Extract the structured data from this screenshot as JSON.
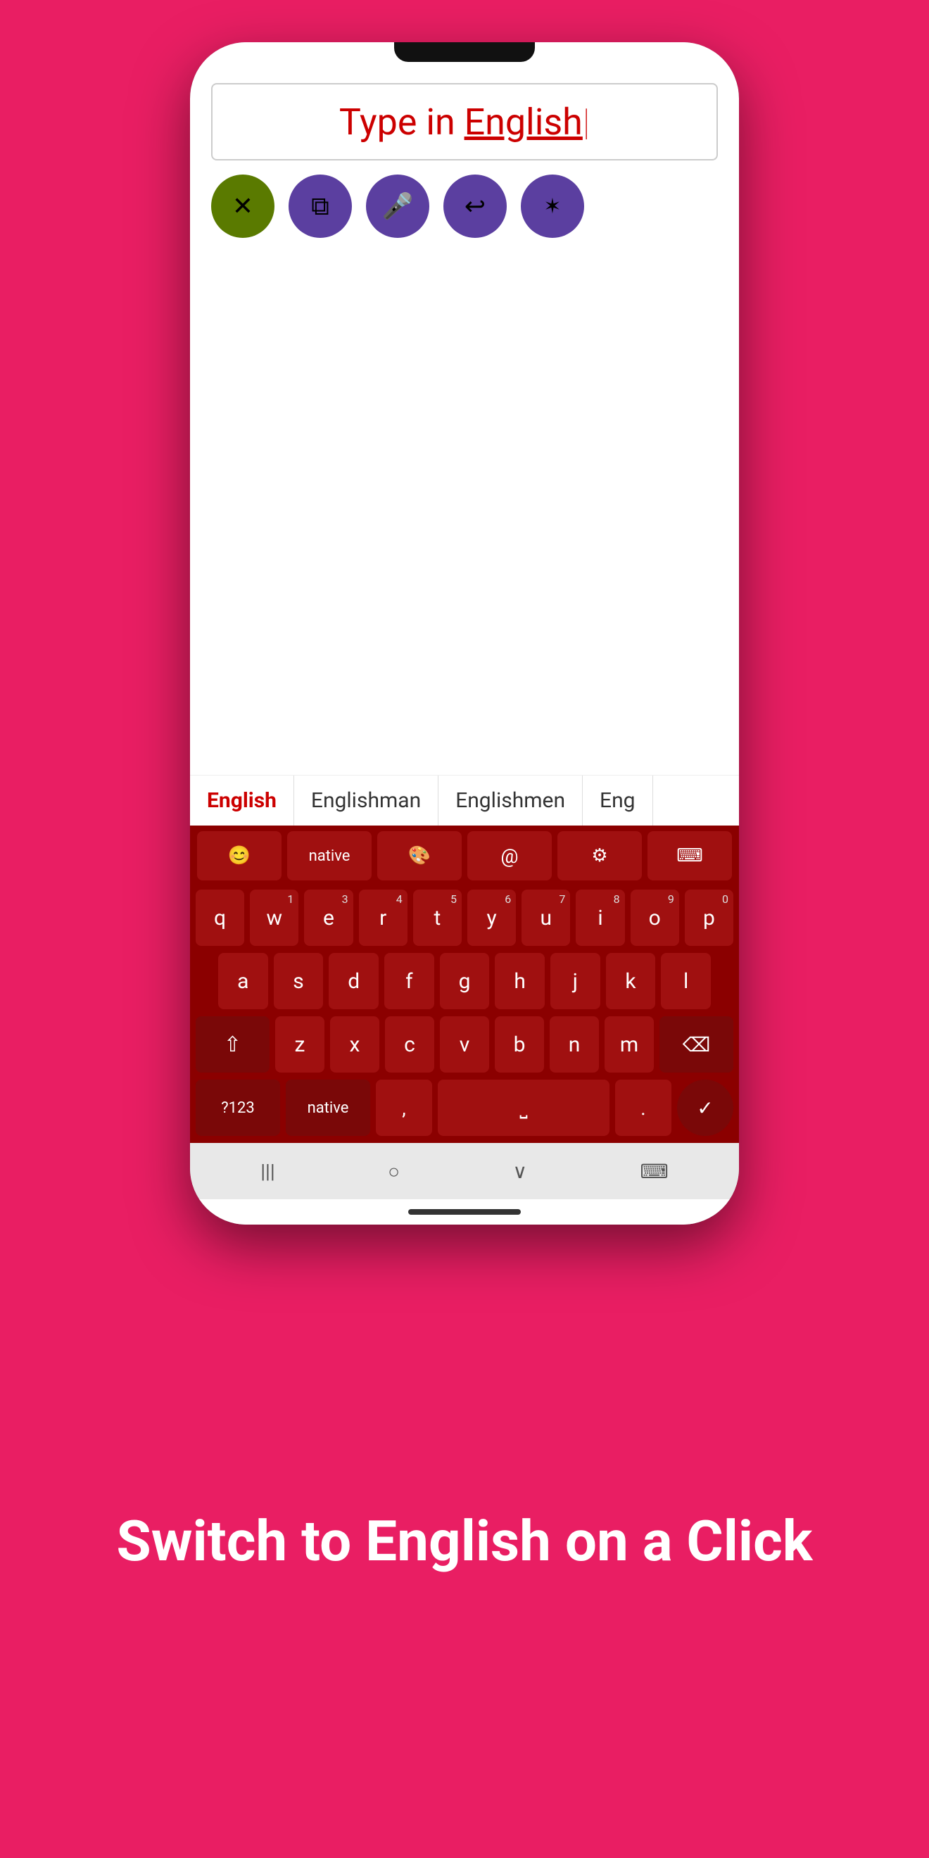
{
  "app": {
    "background_color": "#E91E63"
  },
  "phone": {
    "text_area": {
      "content": "Type in English",
      "type_label": "Type in ",
      "english_label": "English"
    },
    "action_buttons": [
      {
        "id": "delete",
        "icon": "⌫",
        "bg": "#5a7a00",
        "label": "delete"
      },
      {
        "id": "copy",
        "icon": "⧉",
        "bg": "#5b3fa0",
        "label": "copy"
      },
      {
        "id": "mic",
        "icon": "🎤",
        "bg": "#5b3fa0",
        "label": "microphone"
      },
      {
        "id": "undo",
        "icon": "↩",
        "bg": "#5b3fa0",
        "label": "undo"
      },
      {
        "id": "share",
        "icon": "⬡",
        "bg": "#5b3fa0",
        "label": "share"
      }
    ],
    "suggestions": [
      {
        "text": "English",
        "active": true
      },
      {
        "text": "Englishman",
        "active": false
      },
      {
        "text": "Englishmen",
        "active": false
      },
      {
        "text": "Eng",
        "active": false
      }
    ],
    "keyboard": {
      "special_row": [
        {
          "id": "emoji",
          "icon": "😊",
          "label": "emoji"
        },
        {
          "id": "native",
          "text": "native",
          "label": "native-key"
        },
        {
          "id": "palette",
          "icon": "🎨",
          "label": "palette"
        },
        {
          "id": "at",
          "icon": "@",
          "label": "at-symbol"
        },
        {
          "id": "settings",
          "icon": "⚙",
          "label": "settings"
        },
        {
          "id": "keyboard",
          "icon": "⌨",
          "label": "keyboard"
        }
      ],
      "row1": [
        {
          "char": "q",
          "num": "",
          "label": "q"
        },
        {
          "char": "w",
          "num": "1",
          "label": "w"
        },
        {
          "char": "e",
          "num": "3",
          "label": "e"
        },
        {
          "char": "r",
          "num": "4",
          "label": "r"
        },
        {
          "char": "t",
          "num": "5",
          "label": "t"
        },
        {
          "char": "y",
          "num": "6",
          "label": "y"
        },
        {
          "char": "u",
          "num": "7",
          "label": "u"
        },
        {
          "char": "i",
          "num": "8",
          "label": "i"
        },
        {
          "char": "o",
          "num": "9",
          "label": "o"
        },
        {
          "char": "p",
          "num": "0",
          "label": "p"
        }
      ],
      "row2": [
        {
          "char": "a",
          "label": "a"
        },
        {
          "char": "s",
          "label": "s"
        },
        {
          "char": "d",
          "label": "d"
        },
        {
          "char": "f",
          "label": "f"
        },
        {
          "char": "g",
          "label": "g"
        },
        {
          "char": "h",
          "label": "h"
        },
        {
          "char": "j",
          "label": "j"
        },
        {
          "char": "k",
          "label": "k"
        },
        {
          "char": "l",
          "label": "l"
        }
      ],
      "row3": [
        {
          "char": "z",
          "label": "z"
        },
        {
          "char": "x",
          "label": "x"
        },
        {
          "char": "c",
          "label": "c"
        },
        {
          "char": "v",
          "label": "v"
        },
        {
          "char": "b",
          "label": "b"
        },
        {
          "char": "n",
          "label": "n"
        },
        {
          "char": "m",
          "label": "m"
        }
      ],
      "bottom_row": {
        "num_switch": "?123",
        "lang": "native",
        "comma": ",",
        "space": "",
        "period": ".",
        "enter_icon": "✓"
      }
    },
    "nav_bar": {
      "back": "|||",
      "home": "○",
      "recents": "∨",
      "keyboard_switch": "⌨"
    }
  },
  "bottom_section": {
    "text": "Switch to English on a Click"
  }
}
